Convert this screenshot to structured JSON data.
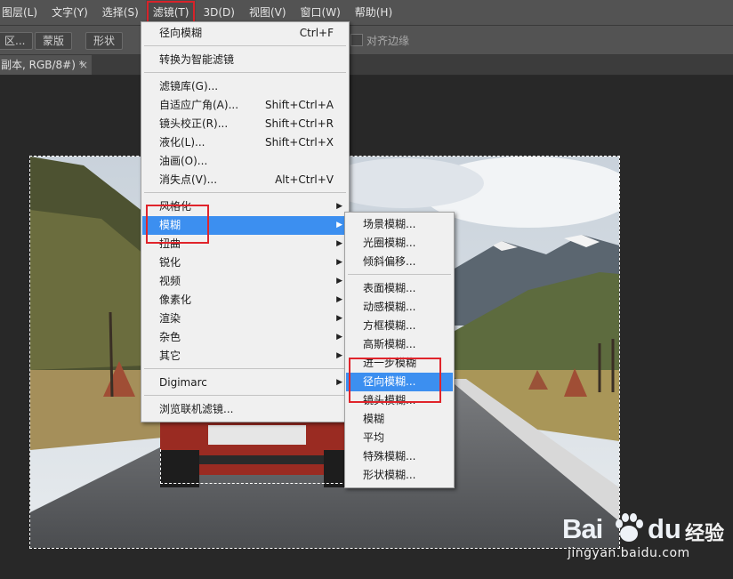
{
  "menubar": {
    "items": [
      "图层(L)",
      "文字(Y)",
      "选择(S)",
      "滤镜(T)",
      "3D(D)",
      "视图(V)",
      "窗口(W)",
      "帮助(H)"
    ]
  },
  "options": {
    "btn1": "区...",
    "btn2": "蒙版",
    "btn3": "形状",
    "align_edges": "对齐边缘"
  },
  "doc_tab": {
    "title": "副本, RGB/8#) *",
    "close": "×"
  },
  "filter_menu": {
    "items": [
      {
        "label": "径向模糊",
        "shortcut": "Ctrl+F"
      },
      {
        "label": "转换为智能滤镜",
        "shortcut": ""
      },
      {
        "label": "滤镜库(G)...",
        "shortcut": ""
      },
      {
        "label": "自适应广角(A)...",
        "shortcut": "Shift+Ctrl+A"
      },
      {
        "label": "镜头校正(R)...",
        "shortcut": "Shift+Ctrl+R"
      },
      {
        "label": "液化(L)...",
        "shortcut": "Shift+Ctrl+X"
      },
      {
        "label": "油画(O)...",
        "shortcut": ""
      },
      {
        "label": "消失点(V)...",
        "shortcut": "Alt+Ctrl+V"
      },
      {
        "label": "风格化",
        "shortcut": ""
      },
      {
        "label": "模糊",
        "shortcut": ""
      },
      {
        "label": "扭曲",
        "shortcut": ""
      },
      {
        "label": "锐化",
        "shortcut": ""
      },
      {
        "label": "视频",
        "shortcut": ""
      },
      {
        "label": "像素化",
        "shortcut": ""
      },
      {
        "label": "渲染",
        "shortcut": ""
      },
      {
        "label": "杂色",
        "shortcut": ""
      },
      {
        "label": "其它",
        "shortcut": ""
      },
      {
        "label": "Digimarc",
        "shortcut": ""
      },
      {
        "label": "浏览联机滤镜...",
        "shortcut": ""
      }
    ]
  },
  "blur_menu": {
    "items": [
      "场景模糊...",
      "光圈模糊...",
      "倾斜偏移...",
      "表面模糊...",
      "动感模糊...",
      "方框模糊...",
      "高斯模糊...",
      "进一步模糊",
      "径向模糊...",
      "镜头模糊...",
      "模糊",
      "平均",
      "特殊模糊...",
      "形状模糊..."
    ]
  },
  "watermark": {
    "brand_latin_1": "Bai",
    "brand_latin_2": "du",
    "brand_cn": "经验",
    "url": "jingyan.baidu.com"
  },
  "colors": {
    "highlight": "#3c8ff0",
    "annotation_red": "#e0242b",
    "menubar_bg": "#535353",
    "workspace_bg": "#282828"
  }
}
